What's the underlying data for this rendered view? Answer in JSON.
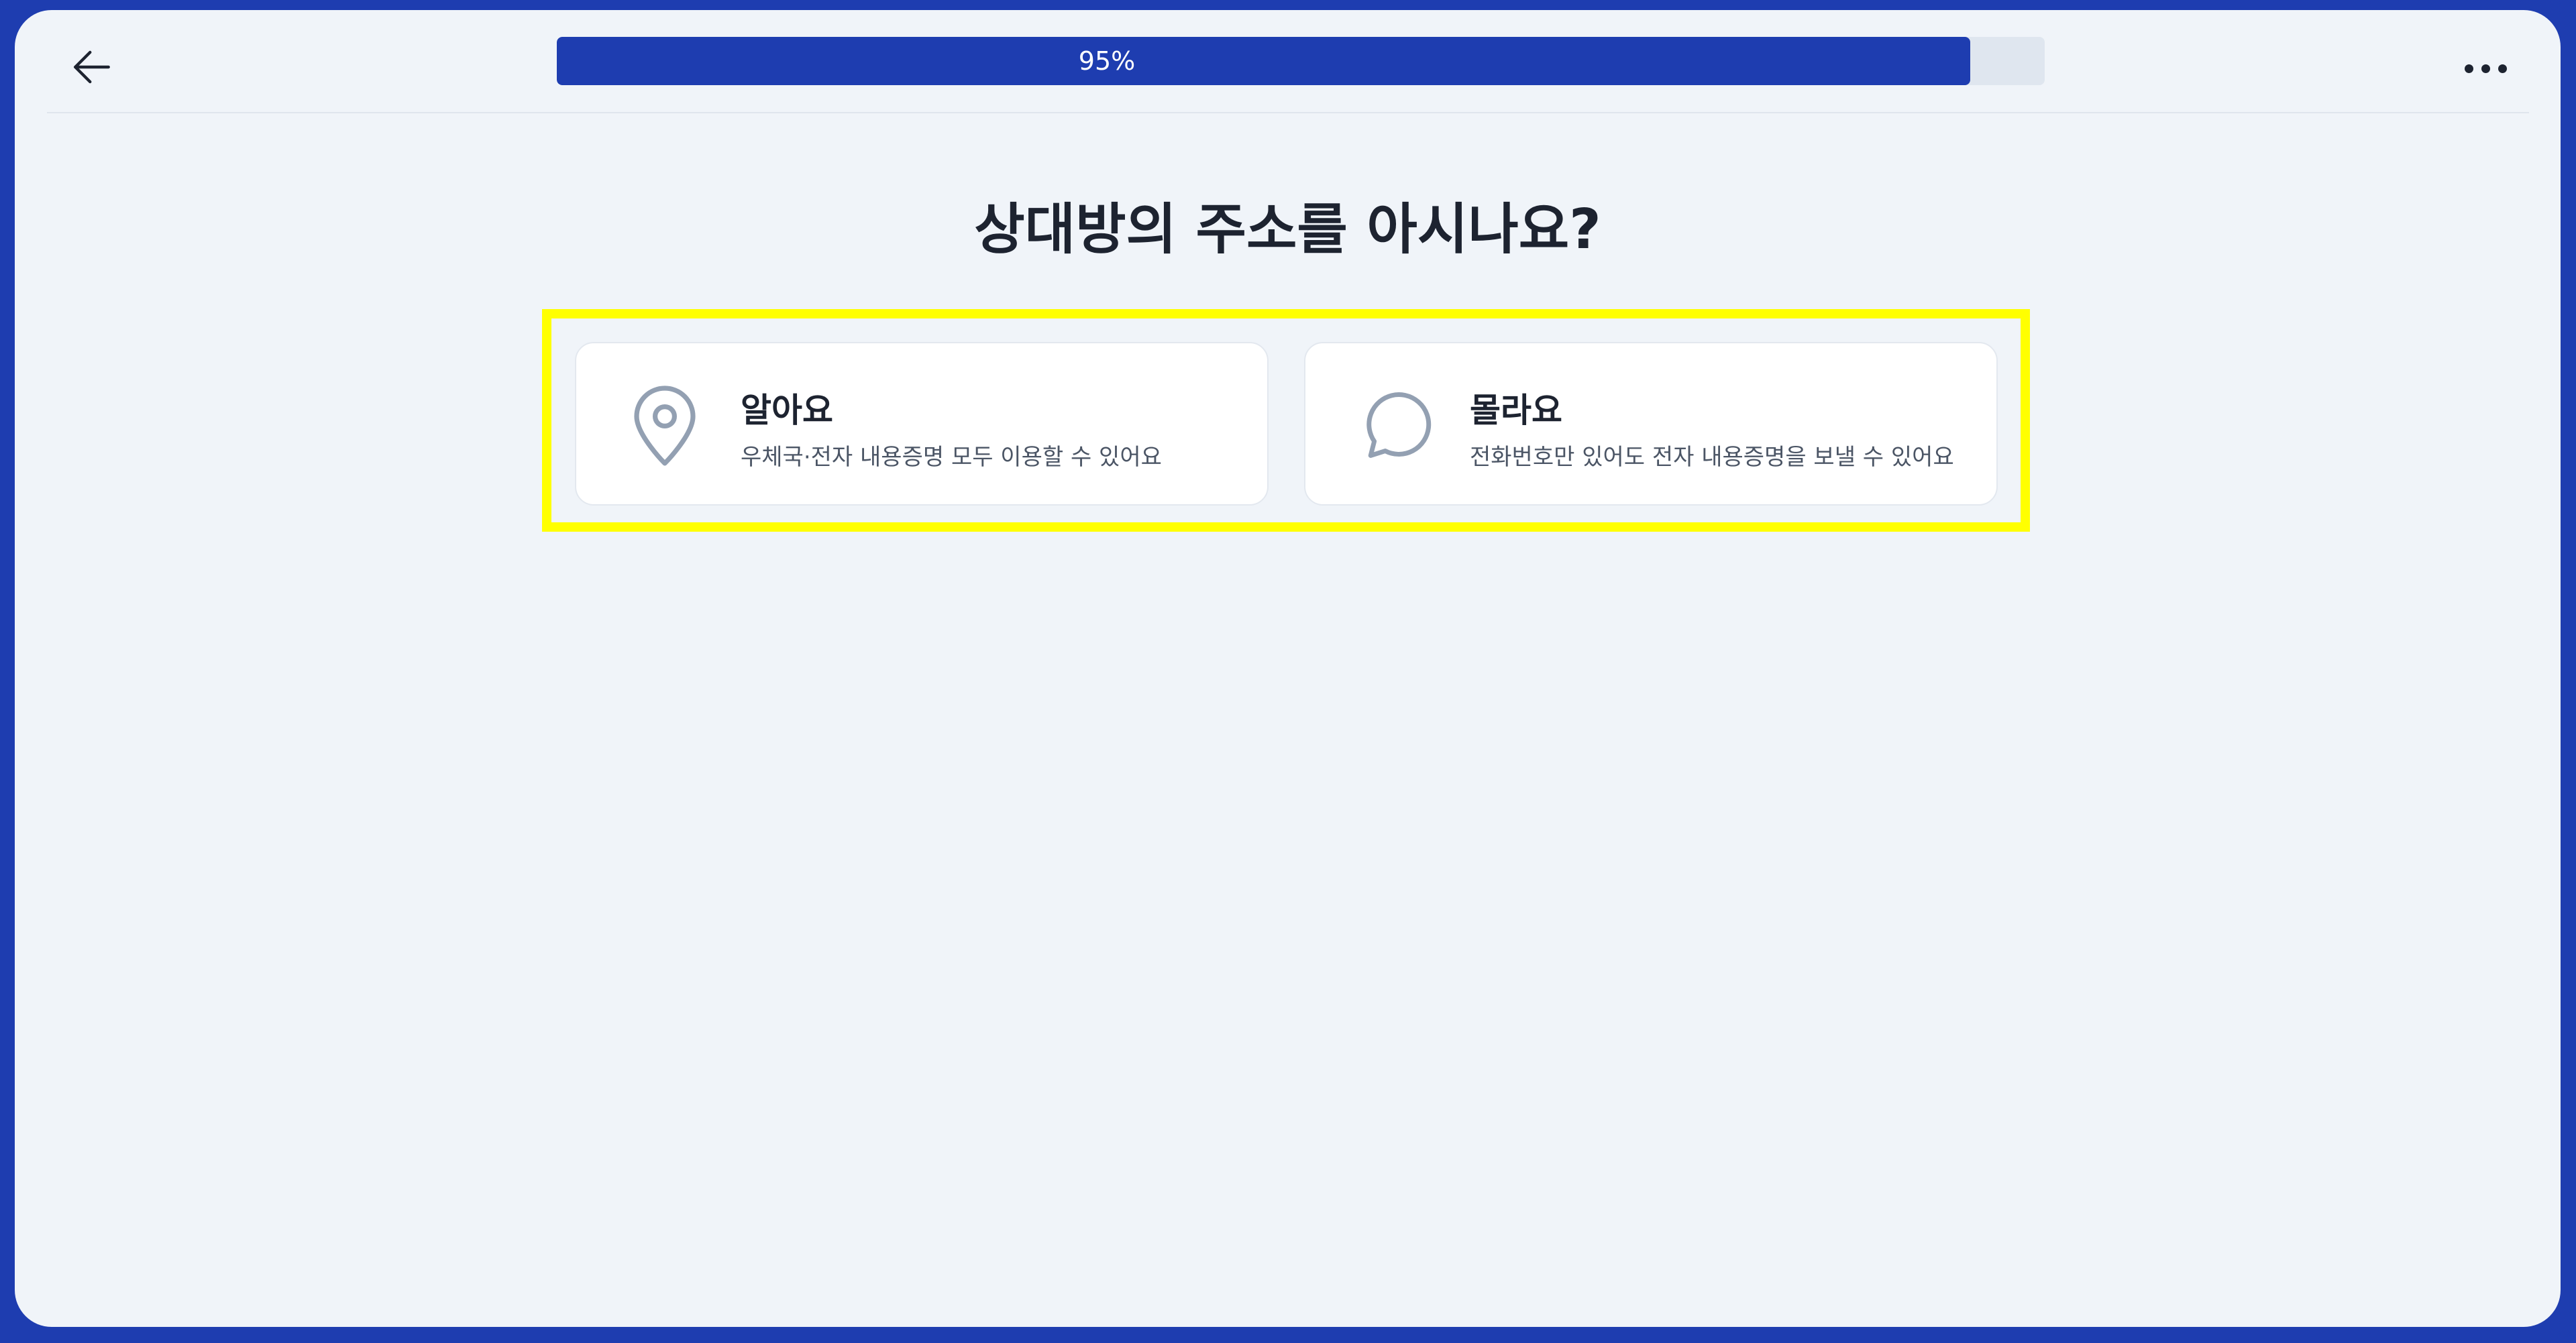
{
  "header": {
    "back_icon": "arrow-left-icon",
    "progress": {
      "percent": 95,
      "label": "95%",
      "fill_color": "#1e3db0",
      "track_color": "#dfe6ef"
    },
    "more_icon": "more-horizontal-icon"
  },
  "main": {
    "title": "상대방의 주소를 아시나요?",
    "options": [
      {
        "icon": "map-pin-icon",
        "title": "알아요",
        "description": "우체국·전자 내용증명 모두 이용할 수 있어요"
      },
      {
        "icon": "chat-bubble-icon",
        "title": "몰라요",
        "description": "전화번호만 있어도 전자 내용증명을 보낼 수 있어요"
      }
    ]
  },
  "colors": {
    "accent": "#1e3db0",
    "background": "#f0f4f9",
    "highlight": "#ffff00",
    "text": "#1d2330",
    "icon": "#93a0b2"
  }
}
